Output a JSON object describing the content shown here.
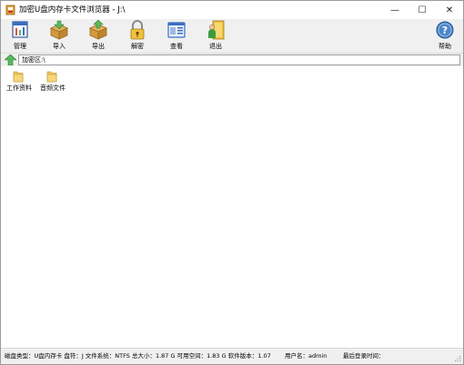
{
  "window": {
    "title": "加密U盘内存卡文件浏览器 - J:\\",
    "controls": {
      "minimize": "—",
      "maximize": "☐",
      "close": "✕"
    }
  },
  "toolbar": {
    "manage": "管理",
    "import": "导入",
    "export": "导出",
    "decrypt": "解密",
    "view": "查看",
    "exit": "退出",
    "help": "帮助"
  },
  "address": {
    "path": "加密区:\\"
  },
  "files": [
    {
      "name": "工作资料",
      "icon": "folder-icon"
    },
    {
      "name": "音频文件",
      "icon": "folder-icon"
    }
  ],
  "status": {
    "disk_info": "磁盘类型：U盘内存卡  盘符：J  文件系统：NTFS  总大小：1.87 G  可用空间：1.83 G  软件版本：1.07",
    "user": "用户名：admin",
    "last_login": "最后登录时间："
  },
  "colors": {
    "toolbar_bg": "#f0f0f0",
    "folder": "#f0c75a",
    "accent_green": "#5cb85c"
  }
}
